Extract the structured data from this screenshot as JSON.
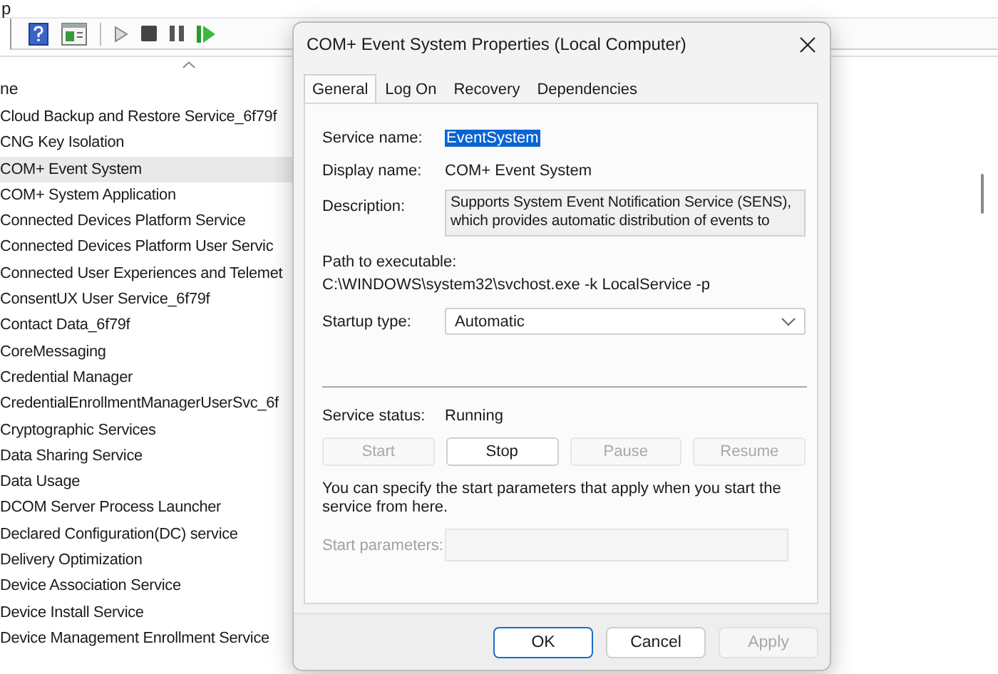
{
  "background_window": {
    "menu_text": "p",
    "column_header": "ne",
    "services": [
      {
        "name": "Cloud Backup and Restore Service_6f79f",
        "selected": false
      },
      {
        "name": "CNG Key Isolation",
        "selected": false
      },
      {
        "name": "COM+ Event System",
        "selected": true
      },
      {
        "name": "COM+ System Application",
        "selected": false
      },
      {
        "name": "Connected Devices Platform Service",
        "selected": false
      },
      {
        "name": "Connected Devices Platform User Servic",
        "selected": false
      },
      {
        "name": "Connected User Experiences and Telemet",
        "selected": false
      },
      {
        "name": "ConsentUX User Service_6f79f",
        "selected": false
      },
      {
        "name": "Contact Data_6f79f",
        "selected": false
      },
      {
        "name": "CoreMessaging",
        "selected": false
      },
      {
        "name": "Credential Manager",
        "selected": false
      },
      {
        "name": "CredentialEnrollmentManagerUserSvc_6f",
        "selected": false
      },
      {
        "name": "Cryptographic Services",
        "selected": false
      },
      {
        "name": "Data Sharing Service",
        "selected": false
      },
      {
        "name": "Data Usage",
        "selected": false
      },
      {
        "name": "DCOM Server Process Launcher",
        "selected": false
      },
      {
        "name": "Declared Configuration(DC) service",
        "selected": false
      },
      {
        "name": "Delivery Optimization",
        "selected": false
      },
      {
        "name": "Device Association Service",
        "selected": false
      },
      {
        "name": "Device Install Service",
        "selected": false
      },
      {
        "name": "Device Management Enrollment Service",
        "selected": false
      }
    ]
  },
  "dialog": {
    "title": "COM+ Event System Properties (Local Computer)",
    "tabs": [
      {
        "label": "General",
        "selected": true
      },
      {
        "label": "Log On",
        "selected": false
      },
      {
        "label": "Recovery",
        "selected": false
      },
      {
        "label": "Dependencies",
        "selected": false
      }
    ],
    "service_name": {
      "label": "Service name:",
      "value": "EventSystem",
      "highlighted": true
    },
    "display_name": {
      "label": "Display name:",
      "value": "COM+ Event System"
    },
    "description": {
      "label": "Description:",
      "value": "Supports System Event Notification Service (SENS), which provides automatic distribution of events to"
    },
    "path": {
      "label": "Path to executable:",
      "value": "C:\\WINDOWS\\system32\\svchost.exe -k LocalService -p"
    },
    "startup_type": {
      "label": "Startup type:",
      "value": "Automatic"
    },
    "service_status": {
      "label": "Service status:",
      "value": "Running"
    },
    "control_buttons": [
      {
        "label": "Start",
        "disabled": true
      },
      {
        "label": "Stop",
        "disabled": false
      },
      {
        "label": "Pause",
        "disabled": true
      },
      {
        "label": "Resume",
        "disabled": true
      }
    ],
    "hint": "You can specify the start parameters that apply when you start the service from here.",
    "start_parameters": {
      "label": "Start parameters:",
      "disabled": true
    },
    "footer_buttons": [
      {
        "label": "OK",
        "default": true,
        "disabled": false
      },
      {
        "label": "Cancel",
        "default": false,
        "disabled": false
      },
      {
        "label": "Apply",
        "default": false,
        "disabled": true
      }
    ]
  }
}
